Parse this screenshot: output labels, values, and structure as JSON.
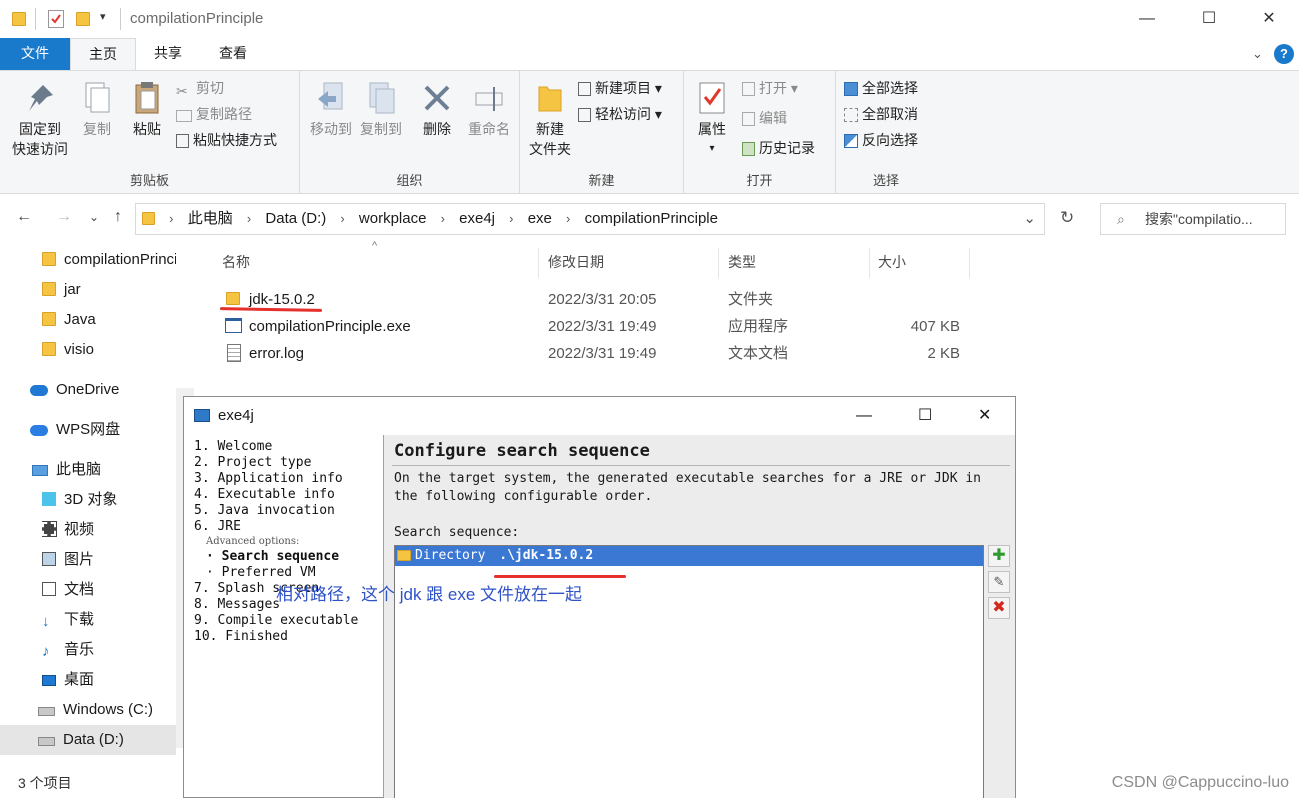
{
  "window": {
    "title": "compilationPrinciple"
  },
  "ribbon_tabs": [
    "文件",
    "主页",
    "共享",
    "查看"
  ],
  "ribbon": {
    "clipboard": {
      "label": "剪贴板",
      "pin_l1": "固定到",
      "pin_l2": "快速访问",
      "copy": "复制",
      "paste": "粘贴",
      "cut": "剪切",
      "copy_path": "复制路径",
      "paste_shortcut": "粘贴快捷方式"
    },
    "organize": {
      "label": "组织",
      "move_to": "移动到",
      "copy_to": "复制到",
      "delete": "删除",
      "rename": "重命名"
    },
    "new": {
      "label": "新建",
      "new_folder_l1": "新建",
      "new_folder_l2": "文件夹",
      "new_item": "新建项目",
      "easy_access": "轻松访问"
    },
    "open": {
      "label": "打开",
      "properties": "属性",
      "open": "打开",
      "edit": "编辑",
      "history": "历史记录"
    },
    "select": {
      "label": "选择",
      "select_all": "全部选择",
      "select_none": "全部取消",
      "invert": "反向选择"
    }
  },
  "address": {
    "crumbs": [
      "此电脑",
      "Data (D:)",
      "workplace",
      "exe4j",
      "exe",
      "compilationPrinciple"
    ],
    "search_placeholder": "搜索\"compilatio..."
  },
  "nav": [
    "compilationPrinciple",
    "jar",
    "Java",
    "visio",
    "OneDrive",
    "WPS网盘",
    "此电脑",
    "3D 对象",
    "视频",
    "图片",
    "文档",
    "下载",
    "音乐",
    "桌面",
    "Windows (C:)",
    "Data (D:)"
  ],
  "columns": {
    "name": "名称",
    "date": "修改日期",
    "type": "类型",
    "size": "大小"
  },
  "files": [
    {
      "name": "jdk-15.0.2",
      "date": "2022/3/31 20:05",
      "type": "文件夹",
      "size": ""
    },
    {
      "name": "compilationPrinciple.exe",
      "date": "2022/3/31 19:49",
      "type": "应用程序",
      "size": "407 KB"
    },
    {
      "name": "error.log",
      "date": "2022/3/31 19:49",
      "type": "文本文档",
      "size": "2 KB"
    }
  ],
  "status": "3 个项目",
  "dialog": {
    "title": "exe4j",
    "steps": [
      "1. Welcome",
      "2. Project type",
      "3. Application info",
      "4. Executable info",
      "5. Java invocation",
      "6. JRE"
    ],
    "advanced_label": "Advanced options:",
    "sub_steps": [
      "· Search sequence",
      "· Preferred VM"
    ],
    "steps2": [
      "7. Splash screen",
      "8. Messages",
      "9. Compile executable",
      "10. Finished"
    ],
    "heading": "Configure search sequence",
    "desc1": "On the target system, the generated executable searches for a JRE or JDK in",
    "desc2": "the following configurable order.",
    "seq_label": "Search sequence:",
    "seq_item_type": "Directory",
    "seq_item_path": ".\\jdk-15.0.2"
  },
  "annotation": "相对路径，这个 jdk 跟 exe 文件放在一起",
  "watermark": "CSDN @Cappuccino-luo"
}
